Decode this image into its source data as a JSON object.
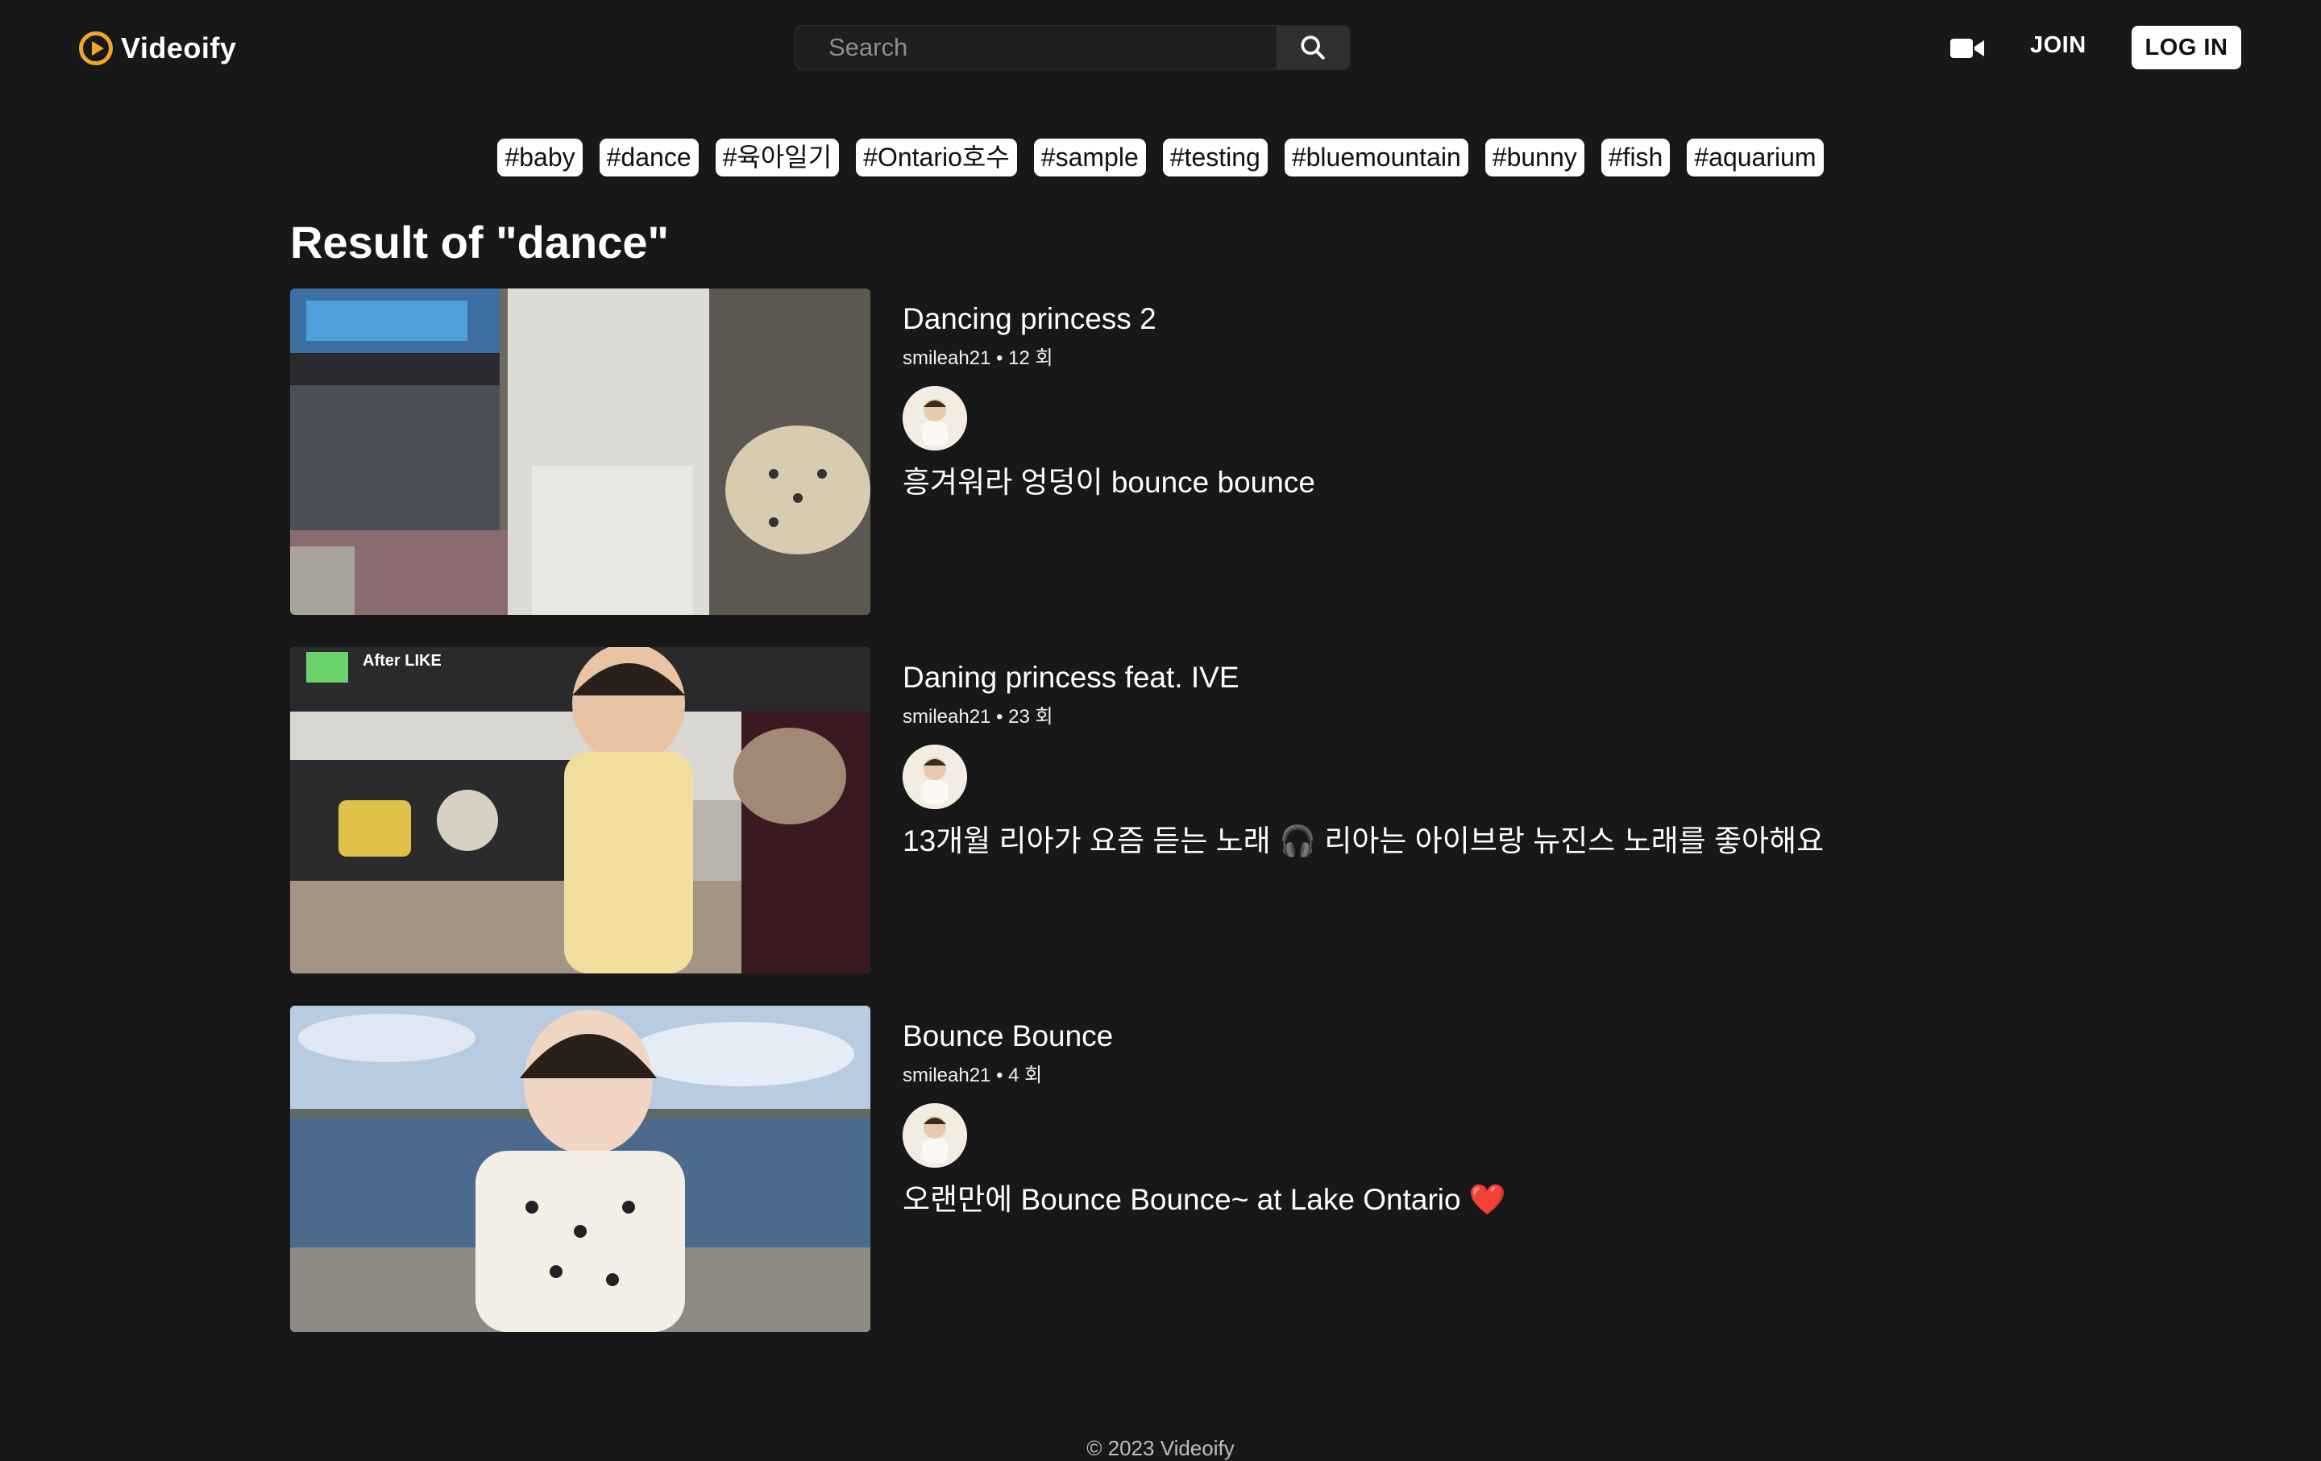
{
  "header": {
    "logo_text": "Videoify",
    "search_placeholder": "Search",
    "upload_icon": "video-camera-icon",
    "join_label": "JOIN",
    "login_label": "LOG IN"
  },
  "hashtags": [
    "#baby",
    "#dance",
    "#육아일기",
    "#Ontario호수",
    "#sample",
    "#testing",
    "#bluemountain",
    "#bunny",
    "#fish",
    "#aquarium"
  ],
  "main": {
    "result_title": "Result of \"dance\""
  },
  "videos": [
    {
      "title": "Dancing princess 2",
      "meta": "smileah21 • 12 회",
      "description": "흥겨워라 엉덩이 bounce bounce"
    },
    {
      "title": "Daning princess feat. IVE",
      "meta": "smileah21 • 23 회",
      "description": "13개월 리아가 요즘 듣는 노래 🎧 리아는 아이브랑 뉴진스 노래를 좋아해요",
      "thumb_overlay": "After LIKE"
    },
    {
      "title": "Bounce Bounce",
      "meta": "smileah21 • 4 회",
      "description": "오랜만에 Bounce Bounce~ at Lake Ontario ❤️"
    }
  ],
  "footer": {
    "text": "© 2023 Videoify"
  },
  "colors": {
    "background": "#181818",
    "accent": "#f5a623"
  }
}
